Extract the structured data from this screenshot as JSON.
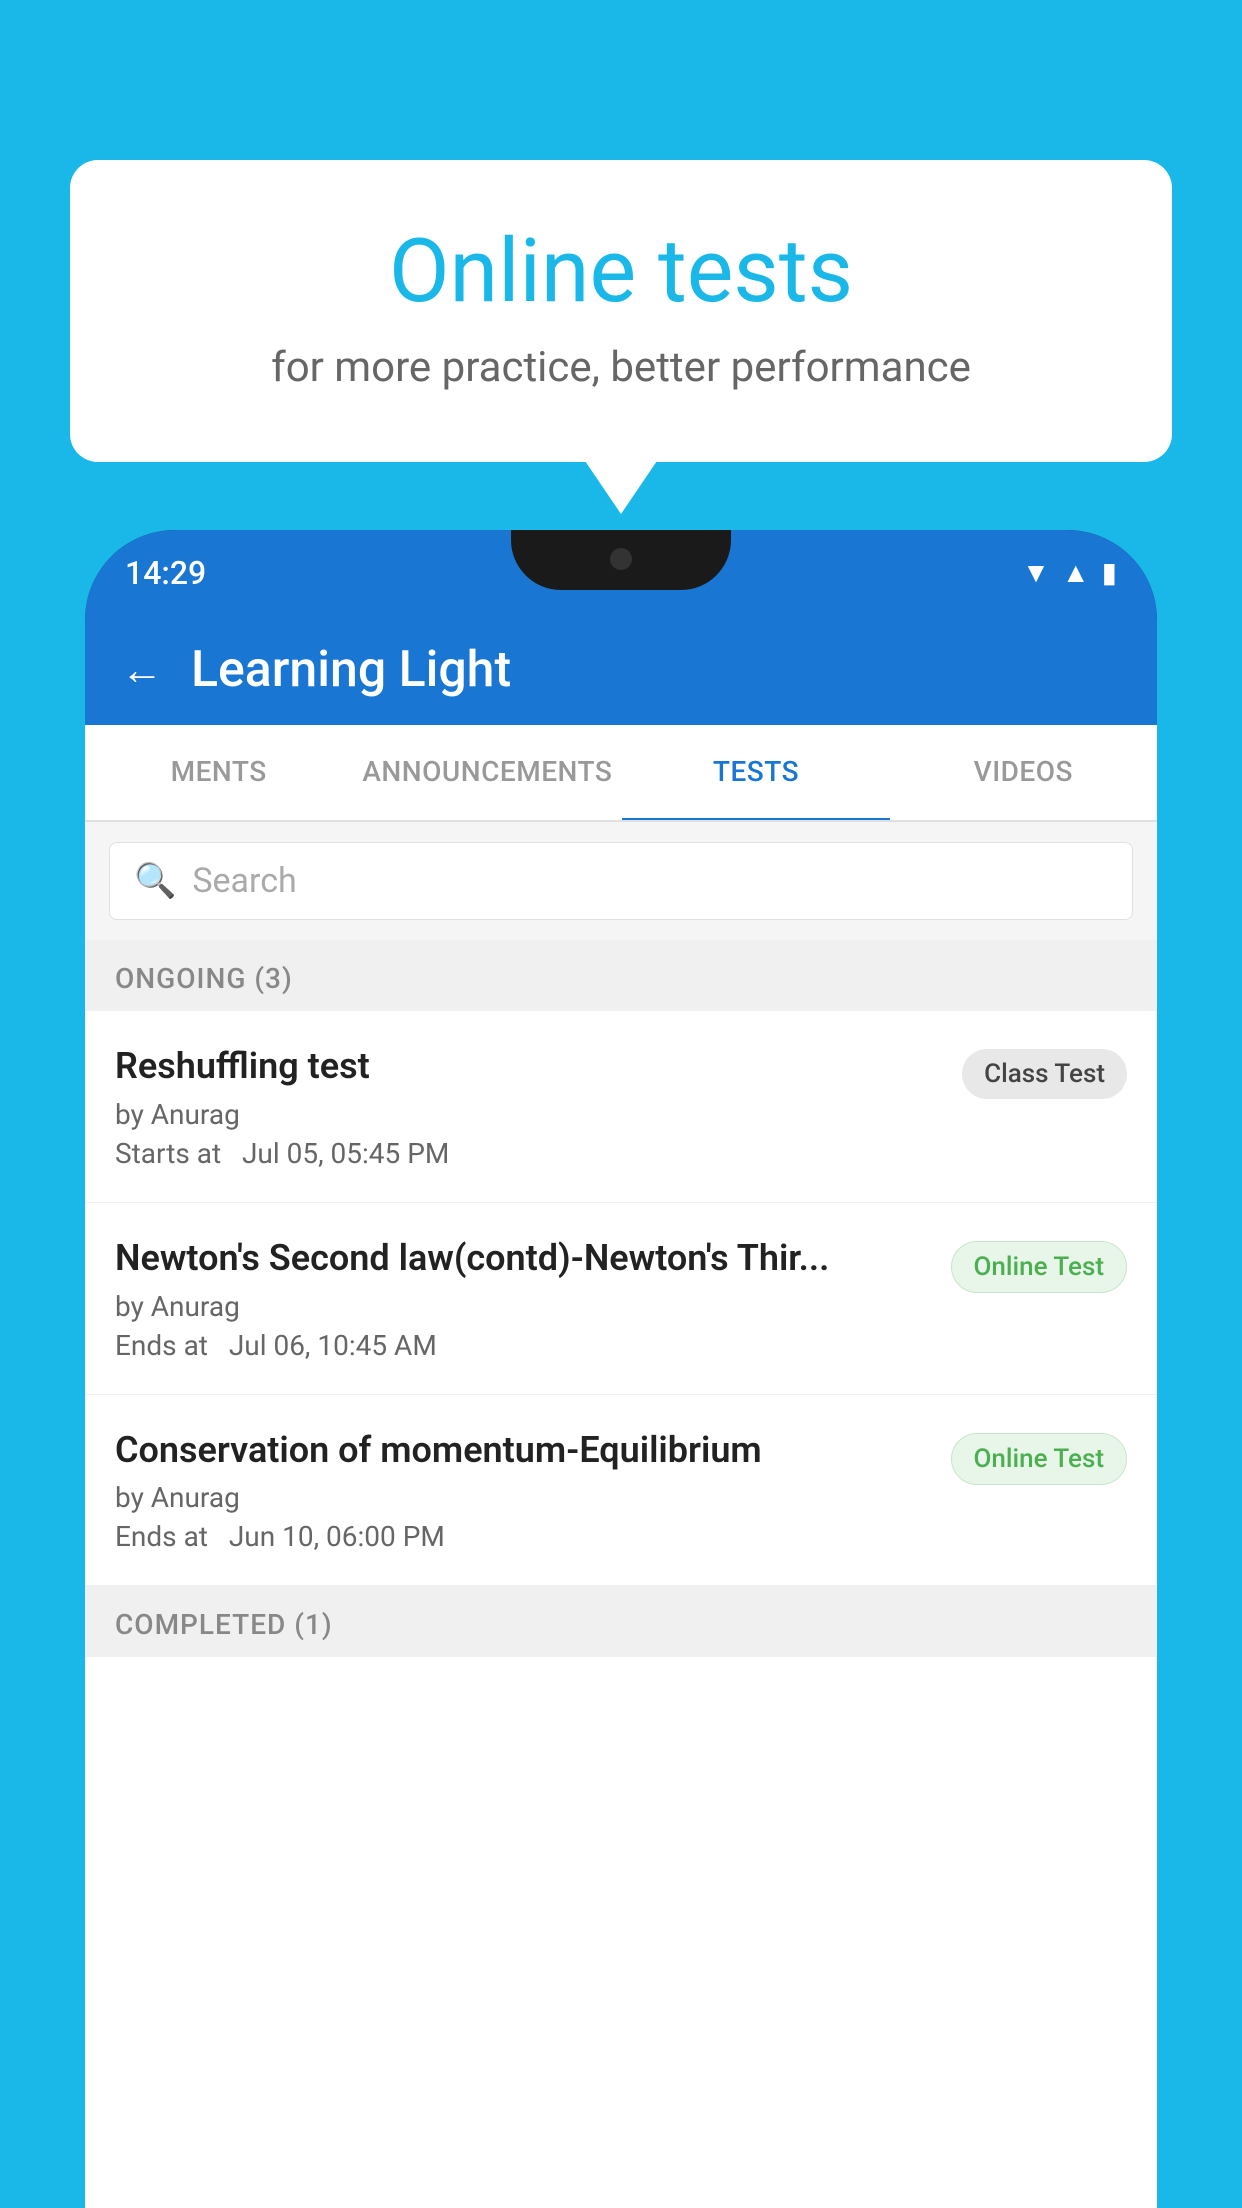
{
  "background_color": "#1ab8e8",
  "speech_bubble": {
    "title": "Online tests",
    "subtitle": "for more practice, better performance"
  },
  "phone": {
    "status_bar": {
      "time": "14:29"
    },
    "app_bar": {
      "back_icon": "←",
      "title": "Learning Light"
    },
    "tabs": [
      {
        "label": "MENTS",
        "active": false
      },
      {
        "label": "ANNOUNCEMENTS",
        "active": false
      },
      {
        "label": "TESTS",
        "active": true
      },
      {
        "label": "VIDEOS",
        "active": false
      }
    ],
    "search": {
      "placeholder": "Search"
    },
    "ongoing_section": {
      "header": "ONGOING (3)",
      "tests": [
        {
          "title": "Reshuffling test",
          "author": "by Anurag",
          "date_label": "Starts at",
          "date": "Jul 05, 05:45 PM",
          "badge": "Class Test",
          "badge_type": "class"
        },
        {
          "title": "Newton's Second law(contd)-Newton's Thir...",
          "author": "by Anurag",
          "date_label": "Ends at",
          "date": "Jul 06, 10:45 AM",
          "badge": "Online Test",
          "badge_type": "online"
        },
        {
          "title": "Conservation of momentum-Equilibrium",
          "author": "by Anurag",
          "date_label": "Ends at",
          "date": "Jun 10, 06:00 PM",
          "badge": "Online Test",
          "badge_type": "online"
        }
      ]
    },
    "completed_section": {
      "header": "COMPLETED (1)"
    }
  }
}
